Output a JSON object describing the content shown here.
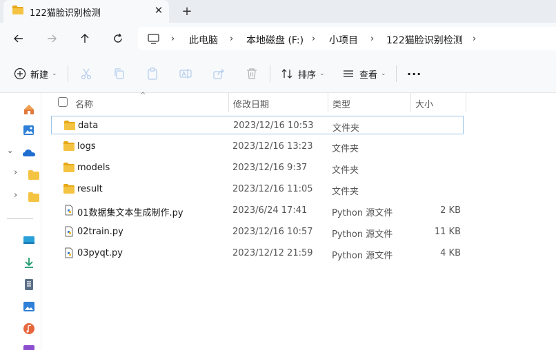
{
  "tab": {
    "title": "122猫脸识别检测",
    "icon": "folder-icon",
    "close_glyph": "✕"
  },
  "new_tab_glyph": "+",
  "nav": {
    "back": "arrow-left-icon",
    "forward": "arrow-right-icon",
    "up": "arrow-up-icon",
    "refresh": "refresh-icon"
  },
  "breadcrumb": [
    {
      "label": "此电脑"
    },
    {
      "label": "本地磁盘 (F:)"
    },
    {
      "label": "小项目"
    },
    {
      "label": "122猫脸识别检测"
    }
  ],
  "breadcrumb_sep": "›",
  "toolbar": {
    "new_label": "新建",
    "sort_label": "排序",
    "view_label": "查看",
    "more_label": "···",
    "caret": "⌄"
  },
  "columns": {
    "name": "名称",
    "date": "修改日期",
    "type": "类型",
    "size": "大小",
    "sort_caret": "^"
  },
  "files": [
    {
      "name": "data",
      "date": "2023/12/16 10:53",
      "type": "文件夹",
      "size": "",
      "kind": "folder"
    },
    {
      "name": "logs",
      "date": "2023/12/16 13:23",
      "type": "文件夹",
      "size": "",
      "kind": "folder"
    },
    {
      "name": "models",
      "date": "2023/12/16 9:37",
      "type": "文件夹",
      "size": "",
      "kind": "folder"
    },
    {
      "name": "result",
      "date": "2023/12/16 11:05",
      "type": "文件夹",
      "size": "",
      "kind": "folder"
    },
    {
      "name": "01数据集文本生成制作.py",
      "date": "2023/6/24 17:41",
      "type": "Python 源文件",
      "size": "2 KB",
      "kind": "python"
    },
    {
      "name": "02train.py",
      "date": "2023/12/16 10:57",
      "type": "Python 源文件",
      "size": "11 KB",
      "kind": "python"
    },
    {
      "name": "03pyqt.py",
      "date": "2023/12/12 21:59",
      "type": "Python 源文件",
      "size": "4 KB",
      "kind": "python"
    }
  ],
  "colors": {
    "folder": "#f5c342",
    "folder_dark": "#e6a817",
    "accent": "#0067c0",
    "selection_border": "#99c3e8"
  }
}
